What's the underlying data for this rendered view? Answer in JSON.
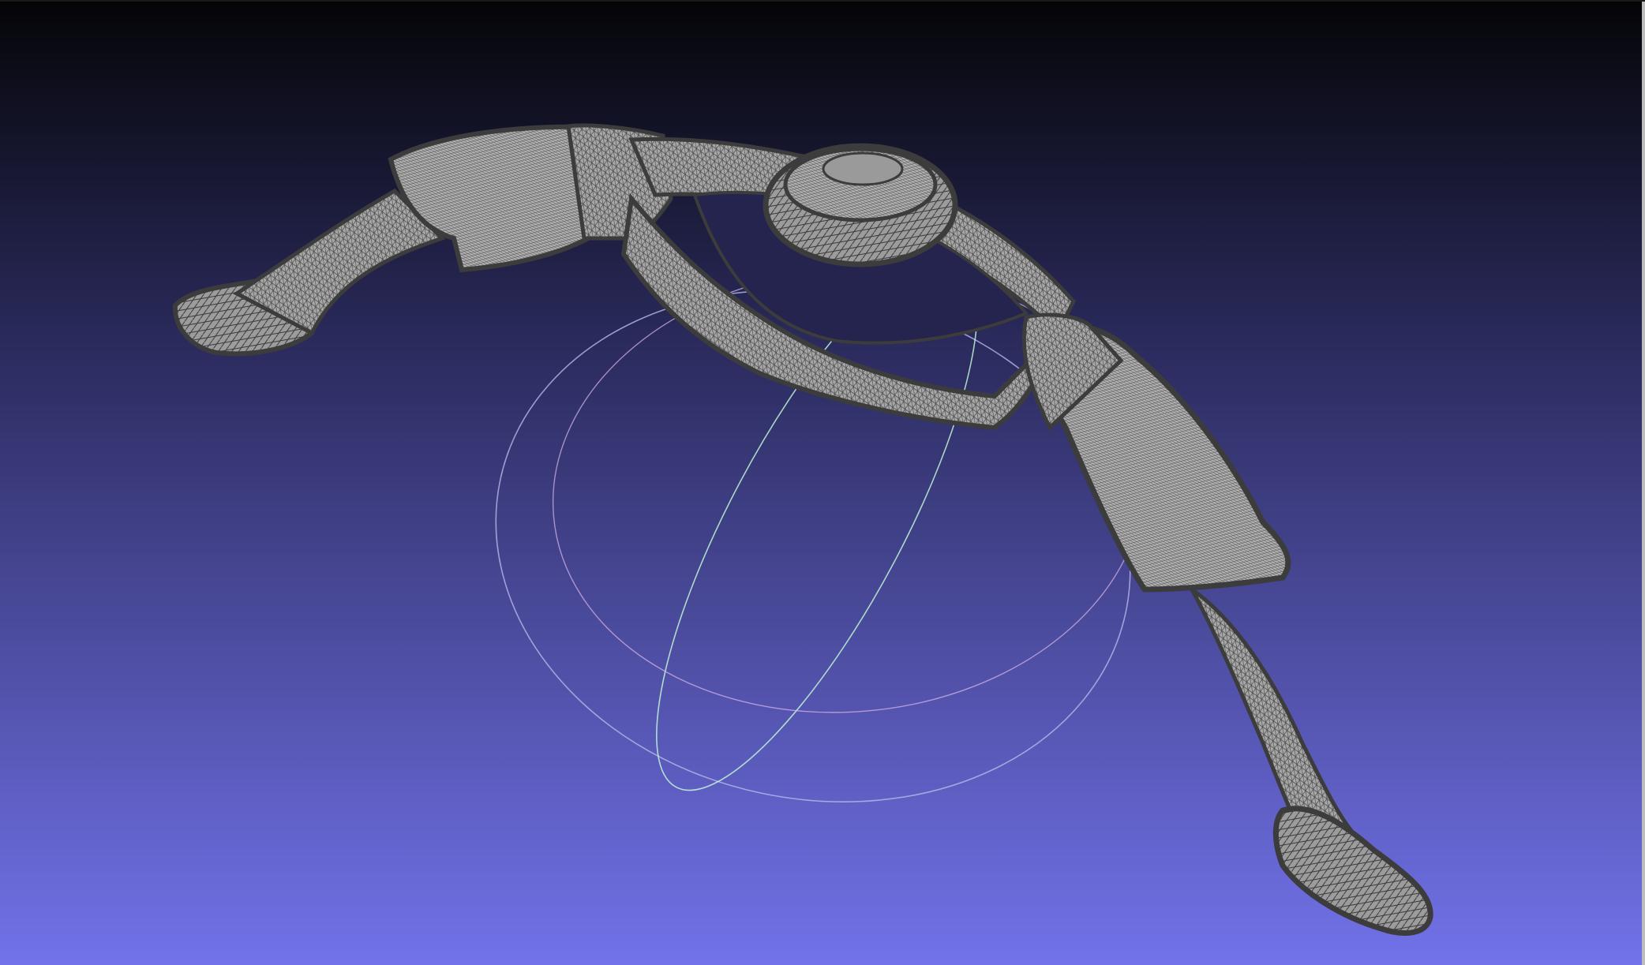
{
  "viewport": {
    "background_top": "#050508",
    "background_mid": "#2a2a5c",
    "background_bottom": "#7272ea",
    "mesh_fill": "#9a9a9a",
    "mesh_edge": "#3c3c3c",
    "mesh_wire": "#d8d8d8"
  },
  "trackball": {
    "ring_colors": [
      "#b8b8e8",
      "#c8ffc8",
      "#ffb0ff"
    ]
  },
  "model": {
    "render_mode": "wireframe-over-flat",
    "icon": "mesh-model-icon"
  }
}
